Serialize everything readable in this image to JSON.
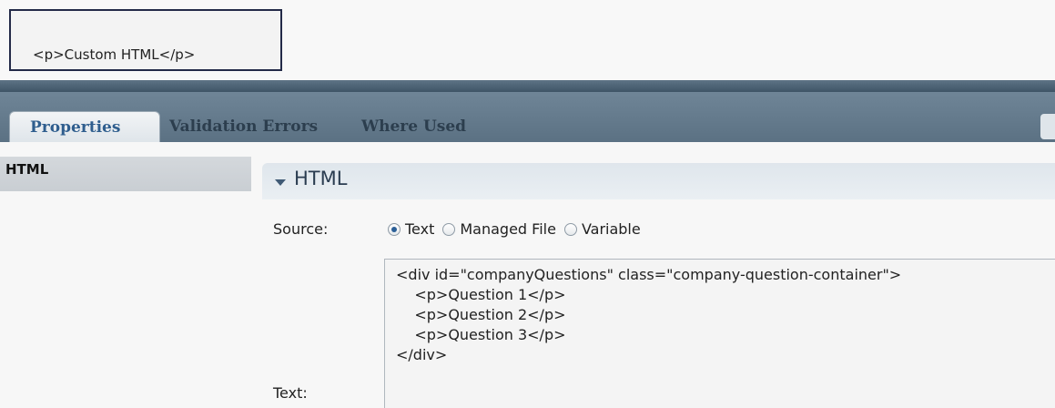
{
  "preview": {
    "text": "<p>Custom HTML</p>"
  },
  "tabs": [
    {
      "label": "Properties",
      "active": true
    },
    {
      "label": "Validation Errors",
      "active": false
    },
    {
      "label": "Where Used",
      "active": false
    }
  ],
  "sidebar": {
    "items": [
      {
        "label": "HTML"
      }
    ]
  },
  "section": {
    "title": "HTML",
    "icon": "chevron-down-icon"
  },
  "source": {
    "label": "Source:",
    "options": [
      {
        "label": "Text",
        "checked": true
      },
      {
        "label": "Managed File",
        "checked": false
      },
      {
        "label": "Variable",
        "checked": false
      }
    ]
  },
  "text_field": {
    "label": "Text:",
    "lines": [
      "<div id=\"companyQuestions\" class=\"company-question-container\">",
      "    <p>Question 1</p>",
      "    <p>Question 2</p>",
      "    <p>Question 3</p>",
      "</div>"
    ]
  },
  "colors": {
    "tab_bar": "#6f8597",
    "active_tab_text": "#2f5e8e",
    "preview_border": "#232a48"
  }
}
